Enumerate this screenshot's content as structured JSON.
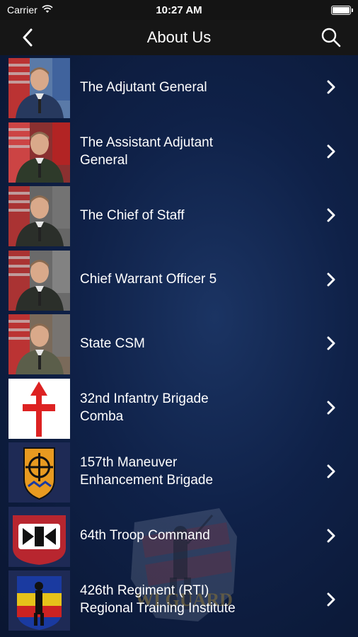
{
  "status_bar": {
    "carrier": "Carrier",
    "time": "10:27 AM",
    "battery_level": 1.0
  },
  "nav": {
    "title": "About Us",
    "back_icon": "chevron-left-icon",
    "search_icon": "search-icon"
  },
  "items": [
    {
      "label": "The Adjutant General",
      "thumb": "portrait-air-force"
    },
    {
      "label": "The Assistant Adjutant General",
      "thumb": "portrait-army-red-flag"
    },
    {
      "label": "The Chief of Staff",
      "thumb": "portrait-army-grey"
    },
    {
      "label": "Chief Warrant Officer 5",
      "thumb": "portrait-army-grey-2"
    },
    {
      "label": "State CSM",
      "thumb": "portrait-army-camo"
    },
    {
      "label": "32nd Infantry Brigade Comba",
      "thumb": "red-arrow-insignia"
    },
    {
      "label": "157th Maneuver Enhancement Brigade",
      "thumb": "mefb-shield-insignia"
    },
    {
      "label": "64th Troop Command",
      "thumb": "badger-insignia"
    },
    {
      "label": "426th Regiment (RTI) Regional Training Institute",
      "thumb": "rti-minuteman-insignia"
    }
  ],
  "watermark": {
    "text": "WI GUARD"
  }
}
